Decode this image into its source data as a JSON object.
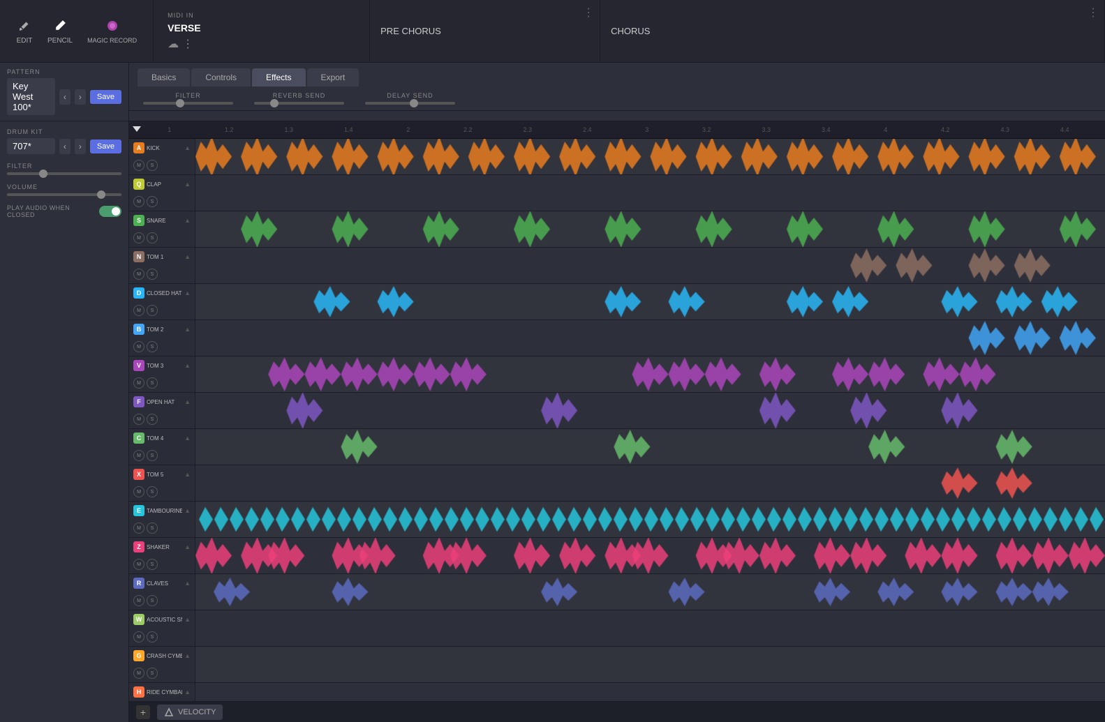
{
  "toolbar": {
    "edit_label": "EDIT",
    "pencil_label": "PENCIL",
    "magic_record_label": "MAGIC RECORD"
  },
  "midi_in": {
    "section_label": "MIDI IN",
    "title": "VERSE",
    "cloud_icon": "☁",
    "dots_icon": "⋮"
  },
  "pre_chorus": {
    "title": "PRE CHORUS",
    "dots_icon": "⋮"
  },
  "chorus": {
    "title": "CHORUS",
    "dots_icon": "⋮"
  },
  "tabs": {
    "basics": "Basics",
    "controls": "Controls",
    "effects": "Effects",
    "export": "Export",
    "active": "Effects"
  },
  "effects": {
    "filter_label": "FILTER",
    "reverb_send_label": "REVERB SEND",
    "delay_send_label": "DELAY SEND"
  },
  "pattern": {
    "section_label": "PATTERN",
    "name": "Key West 100*",
    "save_label": "Save"
  },
  "drum_kit": {
    "section_label": "DRUM KIT",
    "name": "707*",
    "save_label": "Save"
  },
  "filter": {
    "label": "FILTER",
    "value": 30
  },
  "volume": {
    "label": "VOLUME",
    "value": 85
  },
  "play_audio": {
    "label": "PLAY AUDIO WHEN CLOSED",
    "enabled": true
  },
  "ruler": {
    "ticks": [
      "1",
      "1.2",
      "1.3",
      "1.4",
      "2",
      "2.2",
      "2.3",
      "2.4",
      "3",
      "3.2",
      "3.3",
      "3.4",
      "4",
      "4.2",
      "4.3",
      "4.4"
    ]
  },
  "tracks": [
    {
      "id": "A",
      "badge_class": "badge-a",
      "name": "KICK",
      "color": "#e87d1e"
    },
    {
      "id": "Q",
      "badge_class": "badge-q",
      "name": "CLAP",
      "color": "#c0ca33"
    },
    {
      "id": "S",
      "badge_class": "badge-s",
      "name": "SNARE",
      "color": "#4caf50"
    },
    {
      "id": "N",
      "badge_class": "badge-n",
      "name": "TOM 1",
      "color": "#8d6e63"
    },
    {
      "id": "D",
      "badge_class": "badge-d",
      "name": "CLOSED HAT",
      "color": "#29b6f6"
    },
    {
      "id": "B",
      "badge_class": "badge-b",
      "name": "TOM 2",
      "color": "#42a5f5"
    },
    {
      "id": "V",
      "badge_class": "badge-v",
      "name": "TOM 3",
      "color": "#ab47bc"
    },
    {
      "id": "F",
      "badge_class": "badge-f",
      "name": "OPEN HAT",
      "color": "#7e57c2"
    },
    {
      "id": "C",
      "badge_class": "badge-c",
      "name": "TOM 4",
      "color": "#66bb6a"
    },
    {
      "id": "X",
      "badge_class": "badge-x",
      "name": "TOM 5",
      "color": "#ef5350"
    },
    {
      "id": "E",
      "badge_class": "badge-e",
      "name": "TAMBOURINE",
      "color": "#26c6da"
    },
    {
      "id": "Z",
      "badge_class": "badge-z",
      "name": "SHAKER",
      "color": "#ec407a"
    },
    {
      "id": "R",
      "badge_class": "badge-r",
      "name": "CLAVES",
      "color": "#5c6bc0"
    },
    {
      "id": "W",
      "badge_class": "badge-w",
      "name": "ACOUSTIC SNARE",
      "color": "#9ccc65"
    },
    {
      "id": "G",
      "badge_class": "badge-g",
      "name": "CRASH CYMBAL",
      "color": "#ffa726"
    },
    {
      "id": "H",
      "badge_class": "badge-h",
      "name": "RIDE CYMBAL",
      "color": "#ff7043"
    }
  ],
  "velocity": {
    "label": "VELOCITY"
  }
}
